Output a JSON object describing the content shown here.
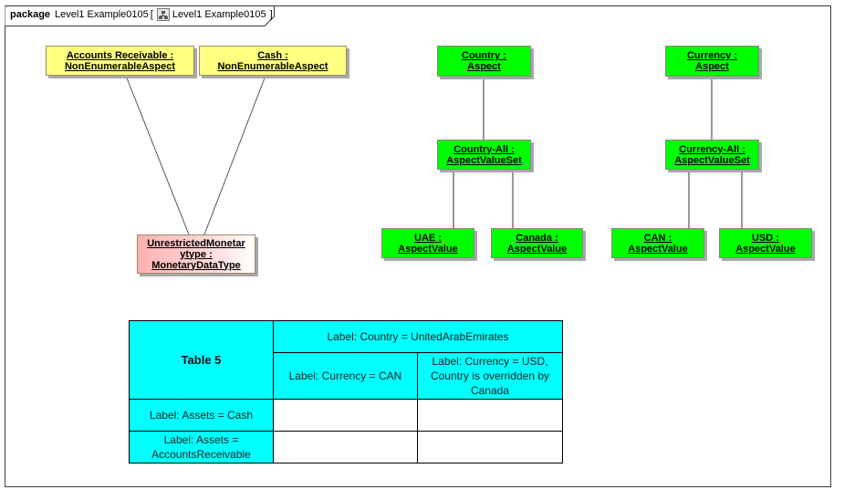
{
  "frame": {
    "keyword": "package",
    "name": "Level1 Example0105",
    "bracket_open": "[",
    "diagram_name": "Level1 Example0105",
    "bracket_close": "]",
    "diagram_icon": "package-diagram-icon"
  },
  "nodes": {
    "accounts_receivable": {
      "line1": "Accounts Receivable :",
      "line2": "NonEnumerableAspect",
      "color": "#ffff80"
    },
    "cash": {
      "line1": "Cash :",
      "line2": "NonEnumerableAspect",
      "color": "#ffff80"
    },
    "unrestricted": {
      "line1": "UnrestrictedMonetar",
      "line2": "ytype :",
      "line3": "MonetaryDataType",
      "color": "#ffb0b0"
    },
    "country": {
      "line1": "Country :",
      "line2": "Aspect",
      "color": "#00ff00"
    },
    "country_all": {
      "line1": "Country-All :",
      "line2": "AspectValueSet",
      "color": "#00ff00"
    },
    "uae": {
      "line1": "UAE :",
      "line2": "AspectValue",
      "color": "#00ff00"
    },
    "canada": {
      "line1": "Canada :",
      "line2": "AspectValue",
      "color": "#00ff00"
    },
    "currency": {
      "line1": "Currency :",
      "line2": "Aspect",
      "color": "#00ff00"
    },
    "currency_all": {
      "line1": "Currency-All :",
      "line2": "AspectValueSet",
      "color": "#00ff00"
    },
    "can": {
      "line1": "CAN :",
      "line2": "AspectValue",
      "color": "#00ff00"
    },
    "usd": {
      "line1": "USD :",
      "line2": "AspectValue",
      "color": "#00ff00"
    }
  },
  "table": {
    "title": "Table 5",
    "header_top": "Label: Country = UnitedArabEmirates",
    "col1": "Label: Currency = CAN",
    "col2": "Label: Currency = USD, Country is overridden by Canada",
    "rows": [
      {
        "label": "Label: Assets = Cash",
        "c1": "",
        "c2": ""
      },
      {
        "label": "Label: Assets = AccountsReceivable",
        "c1": "",
        "c2": ""
      }
    ],
    "header_color": "#00ffff"
  }
}
